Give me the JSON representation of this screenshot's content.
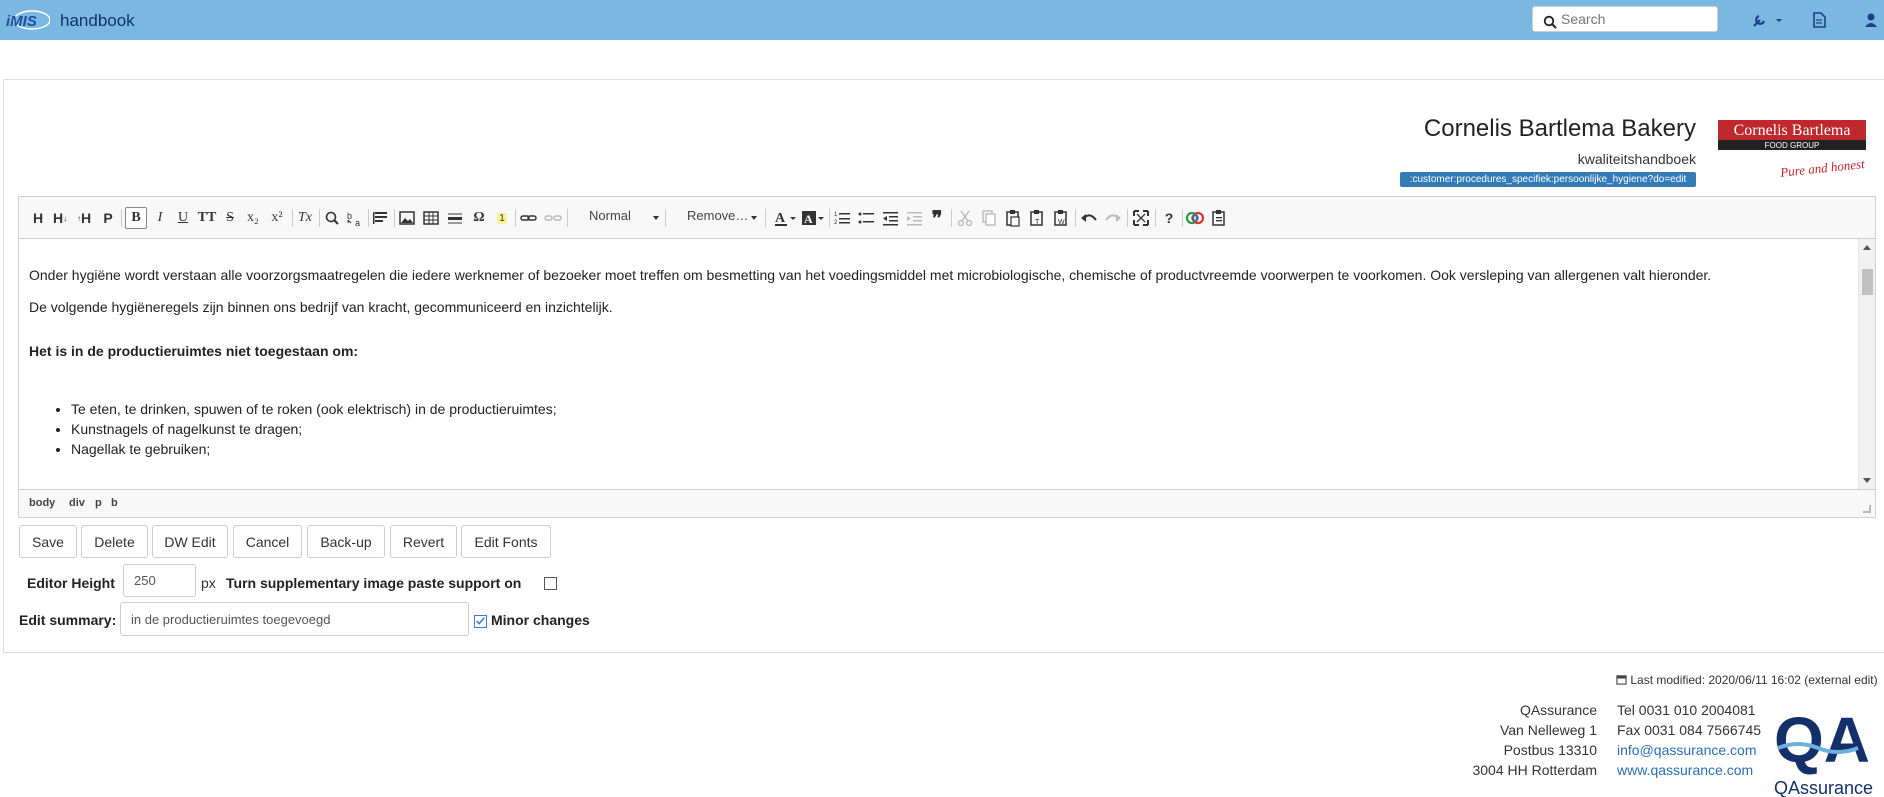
{
  "header": {
    "logo_text": "iMIS",
    "app_title": "handbook",
    "search_placeholder": "Search"
  },
  "page": {
    "company": "Cornelis Bartlema Bakery",
    "subtitle": "kwaliteitshandboek",
    "path_badge": ":customer:procedures_specifiek:persoonlijke_hygiene?do=edit",
    "brand_logo": {
      "line1": "Cornelis Bartlema",
      "line2": "FOOD GROUP",
      "tagline": "Pure and honest"
    }
  },
  "toolbar": {
    "h1": "H",
    "h2": "H",
    "h3": "H",
    "p": "P",
    "bold": "B",
    "italic": "I",
    "underline": "U",
    "mono": "TT",
    "strike": "S",
    "sub": "x₂",
    "sup": "x²",
    "clear": "Tx",
    "omega": "Ω",
    "footnote": "1",
    "format_select": "Normal",
    "remove_select": "Remove…",
    "quote": "❞",
    "help": "?"
  },
  "content": {
    "para1": "Onder hygiëne wordt verstaan alle voorzorgsmaatregelen die iedere werknemer of bezoeker moet treffen om besmetting van het voedingsmiddel met microbiologische, chemische of productvreemde voorwerpen te voorkomen. Ook versleping van allergenen valt hieronder.",
    "para2": "De volgende hygiëneregels zijn binnen ons bedrijf van kracht, gecommuniceerd en inzichtelijk.",
    "heading": "Het is in de productieruimtes niet toegestaan om:",
    "items": [
      "Te eten, te drinken, spuwen of te roken (ook elektrisch) in de productieruimtes;",
      "Kunstnagels of nagelkunst te dragen;",
      "Nagellak te gebruiken;"
    ]
  },
  "pathbar": [
    "body",
    "div",
    "p",
    "b"
  ],
  "buttons": {
    "save": "Save",
    "delete": "Delete",
    "dw_edit": "DW Edit",
    "cancel": "Cancel",
    "backup": "Back-up",
    "revert": "Revert",
    "edit_fonts": "Edit Fonts"
  },
  "options": {
    "editor_height_label": "Editor Height",
    "editor_height_value": "250",
    "editor_height_unit": "px",
    "paste_support_label": "Turn supplementary image paste support on",
    "edit_summary_label": "Edit summary:",
    "edit_summary_value": "in de productieruimtes toegevoegd",
    "minor_changes_label": "Minor changes"
  },
  "footer": {
    "last_modified": "Last modified: 2020/06/11 16:02 (external edit)",
    "address": [
      "QAssurance",
      "Van Nelleweg 1",
      "Postbus 13310",
      "3004 HH Rotterdam"
    ],
    "tel": "Tel 0031 010 2004081",
    "fax": "Fax 0031 084 7566745",
    "email": "info@qassurance.com",
    "web": "www.qassurance.com",
    "logo_text": "QAssurance",
    "logo_mark": "QA"
  },
  "colors": {
    "topbar": "#7ab8e2",
    "badge": "#337ab7",
    "brand_red": "#c0282d",
    "link": "#2a6fb5"
  }
}
